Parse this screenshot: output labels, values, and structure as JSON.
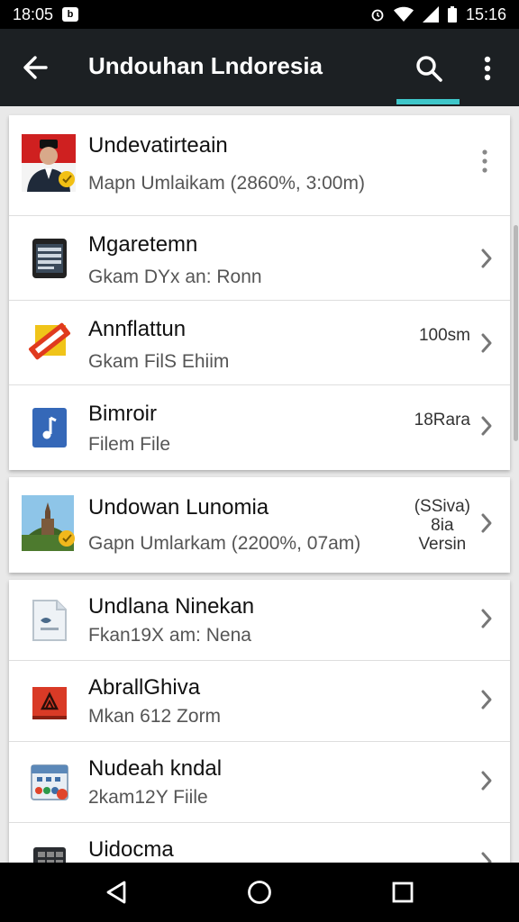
{
  "status_bar": {
    "time_left": "18:05",
    "badge": "b",
    "time_right": "15:16"
  },
  "app_bar": {
    "title": "Undouhan Lndoresia"
  },
  "cards": [
    {
      "rows": [
        {
          "title": "Undevatirteain",
          "subtitle": "Mapn Umlaikam  (2860%, 3:00m)",
          "meta": "",
          "icon": "person-flag-icon",
          "action": "kebab"
        },
        {
          "title": "Mgaretemn",
          "subtitle": "Gkam DYx an: Ronn",
          "meta": "",
          "icon": "tablet-icon",
          "action": "chevron"
        },
        {
          "title": "Annflattun",
          "subtitle": "Gkam FilS Ehiim",
          "meta": "100sm",
          "icon": "ticket-icon",
          "action": "chevron"
        },
        {
          "title": "Bimroir",
          "subtitle": "Filem File",
          "meta": "18Rara",
          "icon": "music-file-icon",
          "action": "chevron"
        }
      ]
    },
    {
      "rows": [
        {
          "title": "Undowan Lunomia",
          "subtitle": "Gapn Umlarkam  (2200%, 07am)",
          "meta": "(SSiva)\n8ia\nVersin",
          "icon": "landmark-photo-icon",
          "action": "chevron"
        }
      ]
    },
    {
      "rows": [
        {
          "title": "Undlana Ninekan",
          "subtitle": "Fkan19X am: Nena",
          "meta": "",
          "icon": "document-icon",
          "action": "chevron"
        },
        {
          "title": "AbrallGhiva",
          "subtitle": "Mkan 612 Zorm",
          "meta": "",
          "icon": "red-book-icon",
          "action": "chevron"
        },
        {
          "title": "Nudeah kndal",
          "subtitle": "2kam12Y Fiile",
          "meta": "",
          "icon": "calendar-card-icon",
          "action": "chevron"
        },
        {
          "title": "Uidocma",
          "subtitle": "",
          "meta": "",
          "icon": "calculator-icon",
          "action": "chevron"
        }
      ]
    }
  ],
  "colors": {
    "app_bar": "#1c2023",
    "accent": "#3ec6c9",
    "background": "#e9e9e9"
  }
}
